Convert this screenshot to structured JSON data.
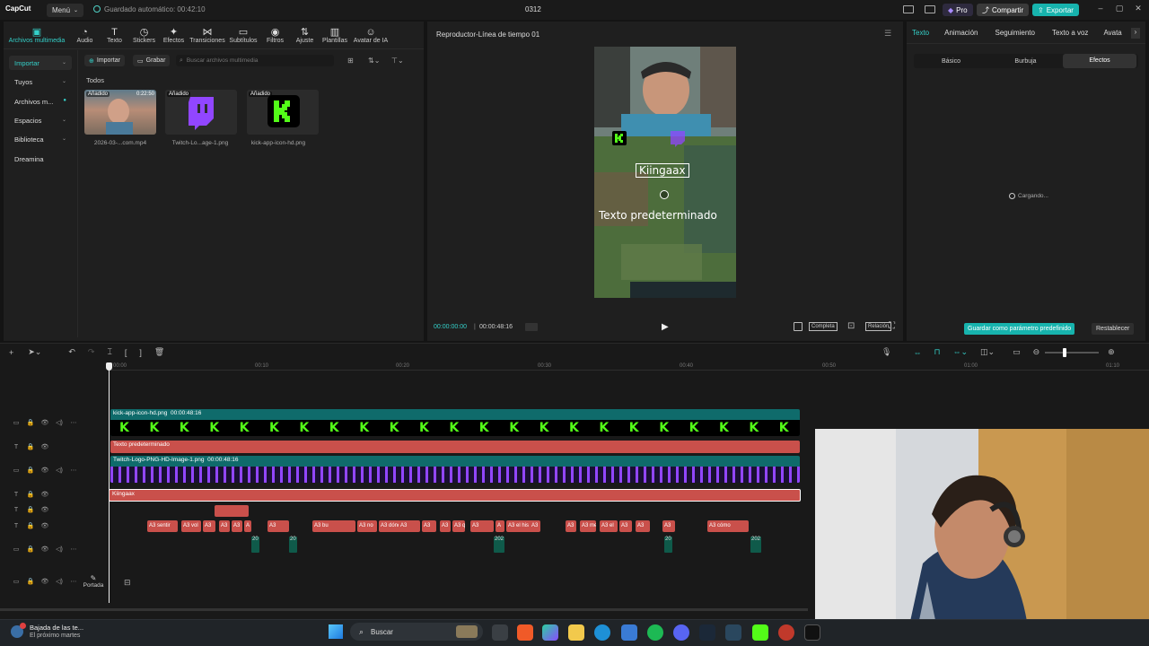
{
  "titlebar": {
    "app_name": "CapCut",
    "menu_label": "Menú",
    "autosave": "Guardado automático: 00:42:10",
    "project_name": "0312",
    "pro_label": "Pro",
    "share_label": "Compartir",
    "export_label": "Exportar"
  },
  "toolbar": [
    {
      "label": "Archivos multimedia",
      "icon": "media-icon"
    },
    {
      "label": "Audio",
      "icon": "audio-icon"
    },
    {
      "label": "Texto",
      "icon": "text-icon"
    },
    {
      "label": "Stickers",
      "icon": "sticker-icon"
    },
    {
      "label": "Efectos",
      "icon": "effects-icon"
    },
    {
      "label": "Transiciones",
      "icon": "transitions-icon"
    },
    {
      "label": "Subtítulos",
      "icon": "subtitles-icon"
    },
    {
      "label": "Filtros",
      "icon": "filters-icon"
    },
    {
      "label": "Ajuste",
      "icon": "adjust-icon"
    },
    {
      "label": "Plantillas",
      "icon": "templates-icon"
    },
    {
      "label": "Avatar de IA",
      "icon": "ai-avatar-icon"
    }
  ],
  "media": {
    "import_btn": "Importar",
    "record_btn": "Grabar",
    "search_placeholder": "Buscar archivos multimedia",
    "section_all": "Todos",
    "sidebar": [
      "Importar",
      "Tuyos",
      "Archivos m...",
      "Espacios",
      "Biblioteca",
      "Dreamina"
    ],
    "items": [
      {
        "badge": "Añadido",
        "duration": "0:22:50",
        "name": "2026-03-...com.mp4"
      },
      {
        "badge": "Añadido",
        "name": "Twitch-Lo...age-1.png"
      },
      {
        "badge": "Añadido",
        "name": "kick-app-icon-hd.png"
      }
    ]
  },
  "player": {
    "title": "Reproductor-Línea de tiempo 01",
    "overlay_text_1": "Kiingaax",
    "overlay_text_2": "Texto predeterminado",
    "time_current": "00:00:00:00",
    "time_total": "00:00:48:16",
    "ratio_label": "Completa",
    "aspect_label": "Relación"
  },
  "props": {
    "tabs": [
      "Texto",
      "Animación",
      "Seguimiento",
      "Texto a voz",
      "Avata"
    ],
    "subtabs": [
      "Básico",
      "Burbuja",
      "Efectos"
    ],
    "loading": "Cargando...",
    "save_preset": "Guardar como parámetro predefinido",
    "reset": "Restablecer"
  },
  "timeline": {
    "ruler": [
      "00:00",
      "00:10",
      "00:20",
      "00:30",
      "00:40",
      "00:50",
      "01:00",
      "01:10"
    ],
    "tracks": [
      {
        "label": "kick-app-icon-hd.png",
        "duration": "00:00:48:16"
      },
      {
        "label": "Texto predeterminado"
      },
      {
        "label": "Twitch-Logo-PNG-HD-Image-1.png",
        "duration": "00:00:48:16"
      },
      {
        "label": "Kiingaax"
      }
    ],
    "subtitle_snippets": [
      "A3 sentir",
      "A3 vol",
      "A3",
      "A3",
      "A3",
      "A",
      "A3",
      "A3 bu",
      "A3 no",
      "A3 dónde",
      "A3",
      "A3",
      "A3",
      "A3 que",
      "A3",
      "A",
      "A3 el his",
      "A3",
      "A3",
      "A3 me",
      "A3 el",
      "A3",
      "A3",
      "A3",
      "A3 cómo"
    ],
    "audio_markers": [
      "20",
      "20",
      "202",
      "20",
      "202"
    ],
    "cover_label": "Portada"
  },
  "taskbar": {
    "notification_title": "Bajada de las te...",
    "notification_sub": "El próximo martes",
    "search_label": "Buscar"
  },
  "colors": {
    "accent": "#34d0c9",
    "kick_green": "#53fc18",
    "twitch_purple": "#9146ff",
    "text_track": "#c9504b",
    "sticker_track": "#0f6b6b"
  }
}
